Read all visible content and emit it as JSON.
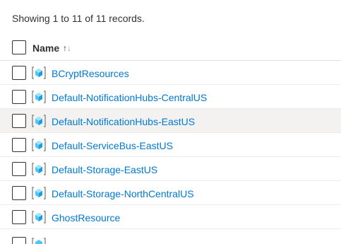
{
  "summary": "Showing 1 to 11 of 11 records.",
  "table": {
    "column_name": "Name",
    "sort_icon": "sort-ascending-icon",
    "rows": [
      {
        "name": "BCryptResources"
      },
      {
        "name": "Default-NotificationHubs-CentralUS"
      },
      {
        "name": "Default-NotificationHubs-EastUS"
      },
      {
        "name": "Default-ServiceBus-EastUS"
      },
      {
        "name": "Default-Storage-EastUS"
      },
      {
        "name": "Default-Storage-NorthCentralUS"
      },
      {
        "name": "GhostResource"
      }
    ],
    "row_icon": "resource-group-icon"
  },
  "colors": {
    "link": "#0078d4",
    "hover_row": "#f3f2f1",
    "text": "#323130"
  }
}
